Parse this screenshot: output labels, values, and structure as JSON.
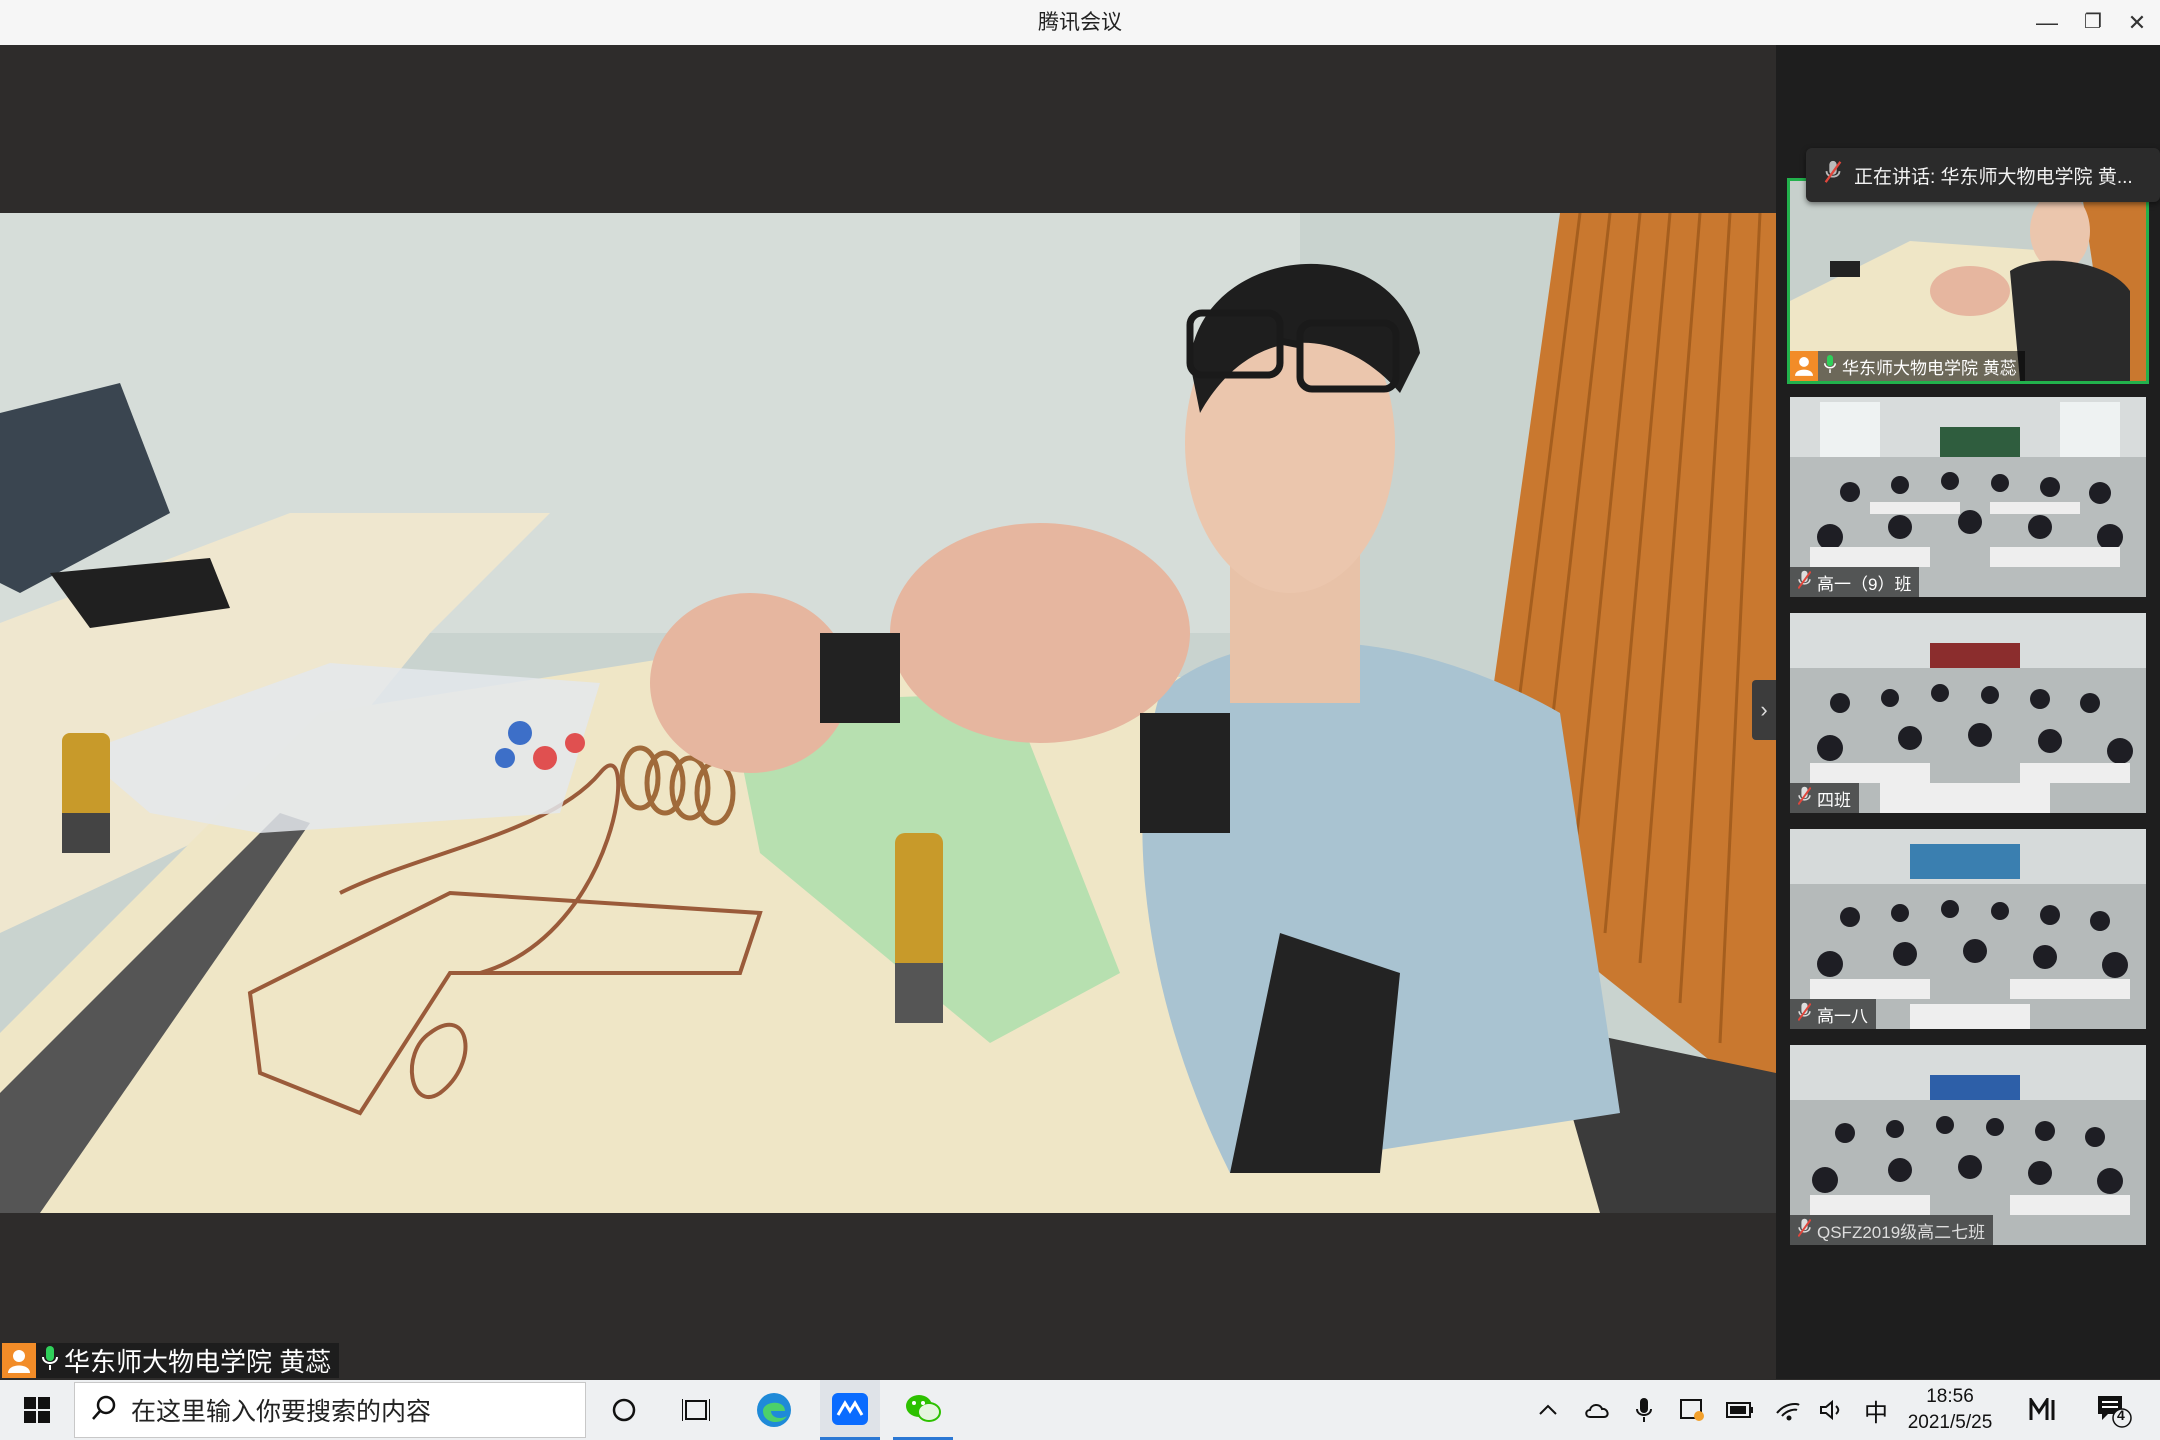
{
  "window": {
    "title": "腾讯会议",
    "minimize_glyph": "—",
    "restore_glyph": "❐",
    "close_glyph": "✕"
  },
  "main_video": {
    "speaker_label": "华东师大物电学院 黄蕊",
    "expand_glyph": "›"
  },
  "side_panel": {
    "speaking_banner": "正在讲话: 华东师大物电学院 黄...",
    "participants": [
      {
        "name": "华东师大物电学院 黄蕊",
        "active": true,
        "mic": "on"
      },
      {
        "name": "高一（9）班",
        "active": false,
        "mic": "muted"
      },
      {
        "name": "四班",
        "active": false,
        "mic": "muted"
      },
      {
        "name": "高一八",
        "active": false,
        "mic": "muted"
      },
      {
        "name": "QSFZ2019级高二七班",
        "active": false,
        "mic": "muted"
      }
    ]
  },
  "taskbar": {
    "search_placeholder": "在这里输入你要搜索的内容",
    "ime": "中",
    "time": "18:56",
    "date": "2021/5/25",
    "notification_count": "4"
  },
  "colors": {
    "accent_green": "#22b14c",
    "avatar_orange": "#f28c28",
    "muted_red": "#e0463c",
    "edge_blue": "#1f8ad8",
    "meeting_blue": "#0a6cff",
    "wechat_green": "#2dc100"
  }
}
